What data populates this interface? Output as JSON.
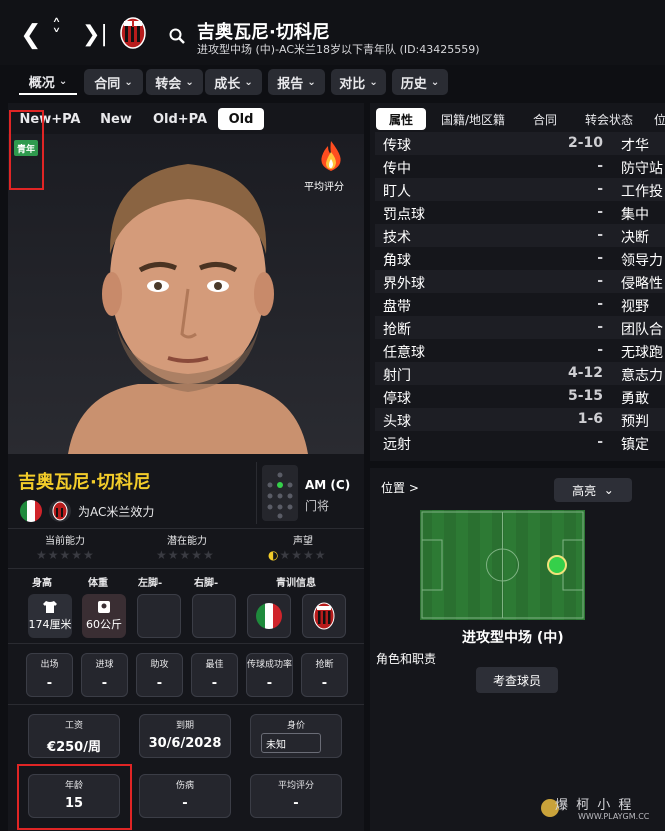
{
  "header": {
    "player_name": "吉奥瓦尼·切科尼",
    "subtitle": "进攻型中场 (中)-AC米兰18岁以下青年队 (ID:43425559)"
  },
  "tabs": [
    {
      "label": "概况"
    },
    {
      "label": "合同"
    },
    {
      "label": "转会"
    },
    {
      "label": "成长"
    },
    {
      "label": "报告"
    },
    {
      "label": "对比"
    },
    {
      "label": "历史"
    }
  ],
  "face_tabs": [
    "New+PA",
    "New",
    "Old+PA",
    "Old"
  ],
  "youth_badge": "青年",
  "avg_rating_label": "平均评分",
  "player": {
    "name": "吉奥瓦尼·切科尼",
    "plays_for": "为AC米兰效力",
    "position": "AM (C)",
    "position_sub": "门将"
  },
  "ratings": {
    "current_label": "当前能力",
    "potential_label": "潜在能力",
    "reputation_label": "声望",
    "reputation_stars": 0.5
  },
  "physical": {
    "height_label": "身高",
    "weight_label": "体重",
    "left_foot_label": "左脚-",
    "right_foot_label": "右脚-",
    "youth_info_label": "青训信息",
    "height": "174厘米",
    "weight": "60公斤"
  },
  "stats": [
    {
      "label": "出场",
      "value": "-"
    },
    {
      "label": "进球",
      "value": "-"
    },
    {
      "label": "助攻",
      "value": "-"
    },
    {
      "label": "最佳",
      "value": "-"
    },
    {
      "label": "传球成功率",
      "value": "-"
    },
    {
      "label": "抢断",
      "value": "-"
    }
  ],
  "contract": {
    "wage_label": "工资",
    "wage": "€250/周",
    "expiry_label": "到期",
    "expiry": "30/6/2028",
    "value_label": "身价",
    "value": "未知"
  },
  "misc": {
    "age_label": "年龄",
    "age": "15",
    "injury_label": "伤病",
    "injury": "-",
    "avg_label": "平均评分",
    "avg": "-"
  },
  "attr_tabs": [
    "属性",
    "国籍/地区籍",
    "合同",
    "转会状态",
    "位"
  ],
  "attributes": [
    {
      "name": "传球",
      "value": "2-10",
      "name2": "才华"
    },
    {
      "name": "传中",
      "value": "-",
      "name2": "防守站"
    },
    {
      "name": "盯人",
      "value": "-",
      "name2": "工作投"
    },
    {
      "name": "罚点球",
      "value": "-",
      "name2": "集中"
    },
    {
      "name": "技术",
      "value": "-",
      "name2": "决断"
    },
    {
      "name": "角球",
      "value": "-",
      "name2": "领导力"
    },
    {
      "name": "界外球",
      "value": "-",
      "name2": "侵略性"
    },
    {
      "name": "盘带",
      "value": "-",
      "name2": "视野"
    },
    {
      "name": "抢断",
      "value": "-",
      "name2": "团队合"
    },
    {
      "name": "任意球",
      "value": "-",
      "name2": "无球跑"
    },
    {
      "name": "射门",
      "value": "4-12",
      "name2": "意志力"
    },
    {
      "name": "停球",
      "value": "5-15",
      "name2": "勇敢"
    },
    {
      "name": "头球",
      "value": "1-6",
      "name2": "预判"
    },
    {
      "name": "远射",
      "value": "-",
      "name2": "镇定"
    }
  ],
  "position_panel": {
    "title": "位置 >",
    "highlight": "高亮",
    "position_name": "进攻型中场 (中)",
    "roles_label": "角色和职责",
    "scout_button": "考查球员"
  },
  "watermark": {
    "text": "爆 柯 小 程",
    "url": "WWW.PLAYGM.CC"
  },
  "colors": {
    "accent_name": "#f2cc2a",
    "youth_badge": "#2f9a4e",
    "pitch": "#2d7a34",
    "highlight_red": "#e02525"
  }
}
